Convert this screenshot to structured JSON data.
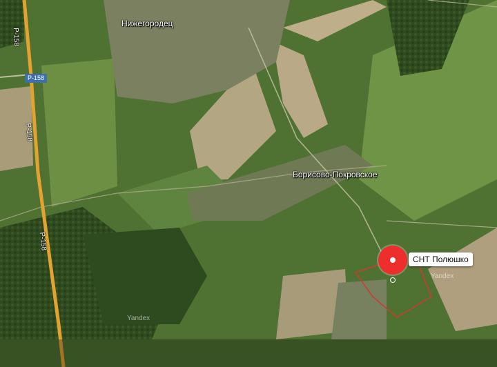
{
  "map": {
    "places": {
      "town_north": "Нижегородец",
      "village_center": "Борисово-Покровское"
    },
    "roads": {
      "highway_ref": "Р-158",
      "highway_ref_vertical": "Р-158",
      "highway_ref_mid": "Р-158",
      "highway_ref_bottom": "Р-158"
    },
    "marker": {
      "label": "СНТ Полюшко",
      "color": "#ee2d2d"
    },
    "watermarks": {
      "right": "Yandex",
      "bottom": "Yandex"
    },
    "colors": {
      "highway": "#e2a330",
      "boundary": "#d03a2e"
    }
  }
}
